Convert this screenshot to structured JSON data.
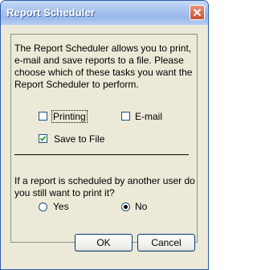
{
  "window": {
    "title": "Report Scheduler"
  },
  "description": "The Report Scheduler allows you to print, e-mail and save reports to a file. Please choose which of these tasks you want the Report Scheduler to perform.",
  "tasks": {
    "printing": {
      "label": "Printing",
      "checked": false
    },
    "email": {
      "label": "E-mail",
      "checked": false
    },
    "save_to_file": {
      "label": "Save to File",
      "checked": true
    }
  },
  "question": "If a report is scheduled by another user do you still want to print it?",
  "options": {
    "yes": {
      "label": "Yes",
      "selected": false
    },
    "no": {
      "label": "No",
      "selected": true
    }
  },
  "buttons": {
    "ok": "OK",
    "cancel": "Cancel"
  },
  "icons": {
    "close": "close-icon",
    "check": "check-icon"
  },
  "colors": {
    "titlebar": "#a9c4ee",
    "background": "#ece9d8",
    "close_button": "#c8502f"
  }
}
